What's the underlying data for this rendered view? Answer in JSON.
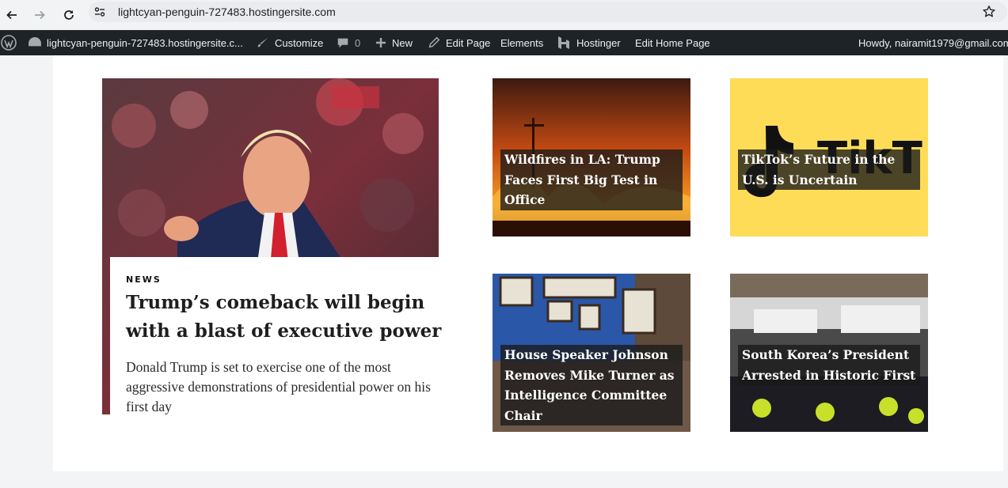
{
  "browser": {
    "url": "lightcyan-penguin-727483.hostingersite.com",
    "icons": [
      "back-arrow-icon",
      "forward-arrow-icon",
      "reload-icon",
      "site-settings-icon",
      "star-icon"
    ]
  },
  "admin_bar": {
    "site_name": "lightcyan-penguin-727483.hostingersite.c...",
    "customize": "Customize",
    "comments_count": "0",
    "new": "New",
    "edit_page": "Edit Page",
    "elements": "Elements",
    "hostinger": "Hostinger",
    "edit_home_page": "Edit Home Page",
    "howdy": "Howdy, nairamit1979@gmail.com"
  },
  "featured": {
    "category": "NEWS",
    "title": "Trump’s comeback will begin with a blast of executive power",
    "excerpt": "Donald Trump is set to exercise one of the most aggressive demonstrations of presidential power on his first day"
  },
  "cards": [
    {
      "title": "Wildfires in LA: Trump Faces First Big Test in Office"
    },
    {
      "title": "TikTok’s Future in the U.S. is Uncertain"
    },
    {
      "title": "House Speaker Johnson Removes Mike Turner as Intelligence Committee Chair"
    },
    {
      "title": "South Korea’s President Arrested in Historic First"
    }
  ],
  "colors": {
    "admin_bar_bg": "#1d2327",
    "page_bg": "#f3f4f6",
    "tiktok_yellow": "#fedc58"
  }
}
